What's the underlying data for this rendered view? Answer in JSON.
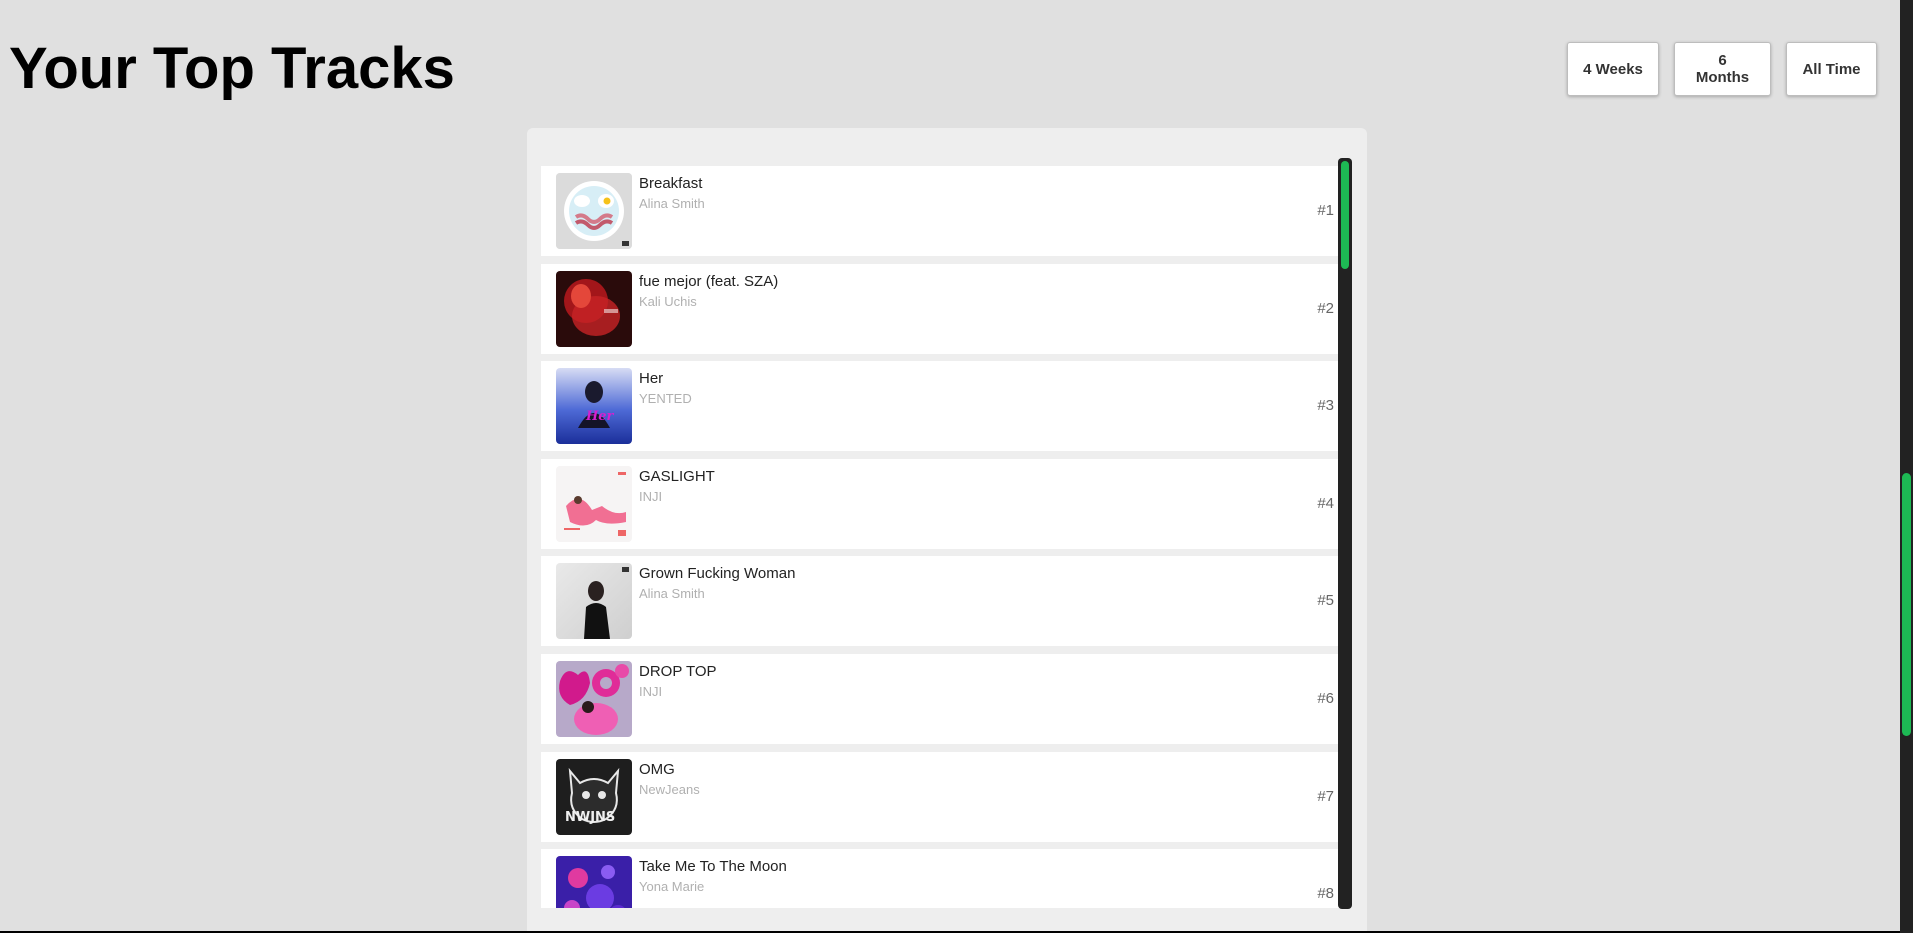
{
  "header": {
    "title": "Your Top Tracks"
  },
  "range": {
    "options": [
      "4 Weeks",
      "6 Months",
      "All Time"
    ]
  },
  "tracks": [
    {
      "name": "Breakfast",
      "artist": "Alina Smith",
      "rank": "#1"
    },
    {
      "name": "fue mejor (feat. SZA)",
      "artist": "Kali Uchis",
      "rank": "#2"
    },
    {
      "name": "Her",
      "artist": "YENTED",
      "rank": "#3"
    },
    {
      "name": "GASLIGHT",
      "artist": "INJI",
      "rank": "#4"
    },
    {
      "name": "Grown Fucking Woman",
      "artist": "Alina Smith",
      "rank": "#5"
    },
    {
      "name": "DROP TOP",
      "artist": "INJI",
      "rank": "#6"
    },
    {
      "name": "OMG",
      "artist": "NewJeans",
      "rank": "#7"
    },
    {
      "name": "Take Me To The Moon",
      "artist": "Yona Marie",
      "rank": "#8"
    }
  ],
  "album_art_text": {
    "her": "Her",
    "omg": "NWJNS"
  },
  "colors": {
    "accent": "#1db954",
    "background": "#e0e0e0",
    "scroll_track": "#222222"
  }
}
